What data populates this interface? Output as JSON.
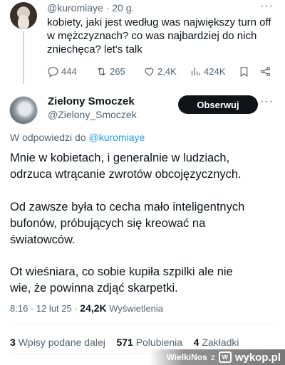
{
  "parent": {
    "handle_and_time": "@kuromiaye · 20 g.",
    "lines": [
      "kobiety, jaki jest według was największy turn off",
      "w mężczyznach? co was najbardziej do nich",
      "zniechęca? let's talk"
    ],
    "more_label": "···",
    "actions": {
      "replies": "444",
      "reposts": "265",
      "likes": "2,4K",
      "views": "424K"
    }
  },
  "tweet": {
    "display_name": "Zielony Smoczek",
    "handle": "@Zielony_Smoczek",
    "follow_label": "Obserwuj",
    "more_label": "···",
    "reply_prefix": "W odpowiedzi do",
    "reply_mention": "@kuromiaye",
    "paragraphs": [
      [
        "Mnie w kobietach, i generalnie w ludziach,",
        "odrzuca wtrącanie zwrotów obcojęzycznych."
      ],
      [
        "Od zawsze była to cecha mało inteligentnych",
        "bufonów, próbujących się kreować na",
        "światowców."
      ],
      [
        "Ot wieśniara, co sobie kupiła szpilki ale nie",
        "wie, że powinna zdjąć skarpetki."
      ]
    ],
    "time_date": "8:16 · 12 lut 25 ·",
    "views_count": "24,2K",
    "views_label": "Wyświetlenia",
    "stats": {
      "reposts_count": "3",
      "reposts_label": "Wpisy podane dalej",
      "likes_count": "571",
      "likes_label": "Polubienia",
      "bookmarks_count": "4",
      "bookmarks_label": "Zakładki"
    }
  },
  "watermark": {
    "user": "WielkiNos",
    "separator": "z",
    "brand": "wykop.pl"
  },
  "icons": {
    "reply": "reply-icon",
    "repost": "repost-icon",
    "like": "heart-icon",
    "views": "views-chart-icon",
    "bookmark": "bookmark-icon",
    "share": "share-icon"
  },
  "colors": {
    "link": "#1d9bf0",
    "text": "#0f1419",
    "secondary": "#536471",
    "button_bg": "#0f1419"
  }
}
